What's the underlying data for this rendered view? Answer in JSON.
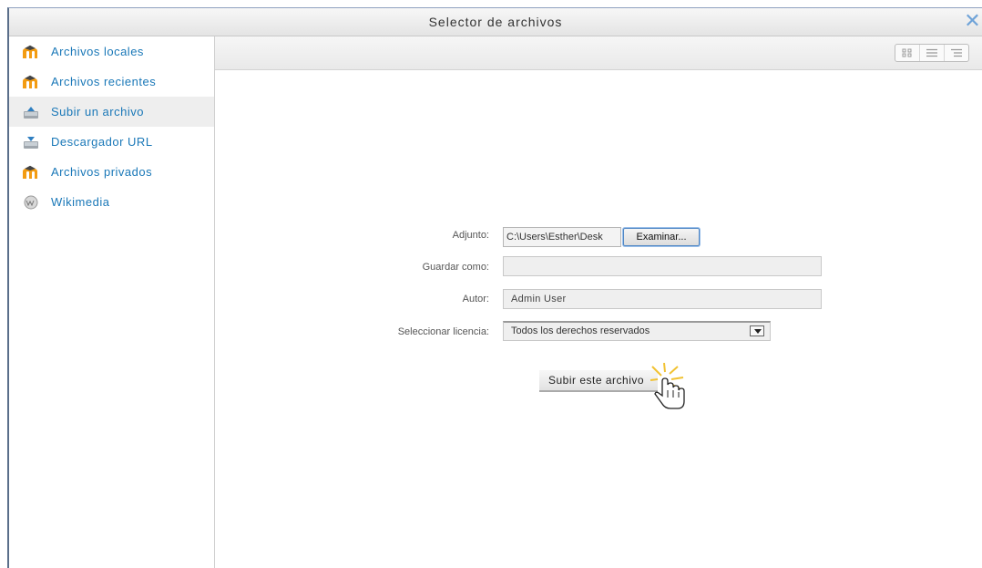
{
  "dialog": {
    "title": "Selector de archivos",
    "close_icon": "close-icon"
  },
  "sidebar": {
    "items": [
      {
        "label": "Archivos locales",
        "icon": "moodle-icon"
      },
      {
        "label": "Archivos recientes",
        "icon": "moodle-icon"
      },
      {
        "label": "Subir un archivo",
        "icon": "upload-icon",
        "active": true
      },
      {
        "label": "Descargador URL",
        "icon": "download-icon"
      },
      {
        "label": "Archivos privados",
        "icon": "moodle-icon"
      },
      {
        "label": "Wikimedia",
        "icon": "wikimedia-icon"
      }
    ]
  },
  "toolbar": {
    "view_icons": [
      "icons-view-icon",
      "list-view-icon",
      "tree-view-icon"
    ]
  },
  "form": {
    "attachment_label": "Adjunto:",
    "attachment_value": "C:\\Users\\Esther\\Desk",
    "browse_label": "Examinar...",
    "saveas_label": "Guardar como:",
    "saveas_value": "",
    "author_label": "Autor:",
    "author_value": "Admin User",
    "license_label": "Seleccionar licencia:",
    "license_value": "Todos los derechos reservados",
    "submit_label": "Subir este archivo"
  },
  "colors": {
    "link": "#1a78b8",
    "close": "#6fa3d8",
    "active_bg": "#eeeeee"
  }
}
